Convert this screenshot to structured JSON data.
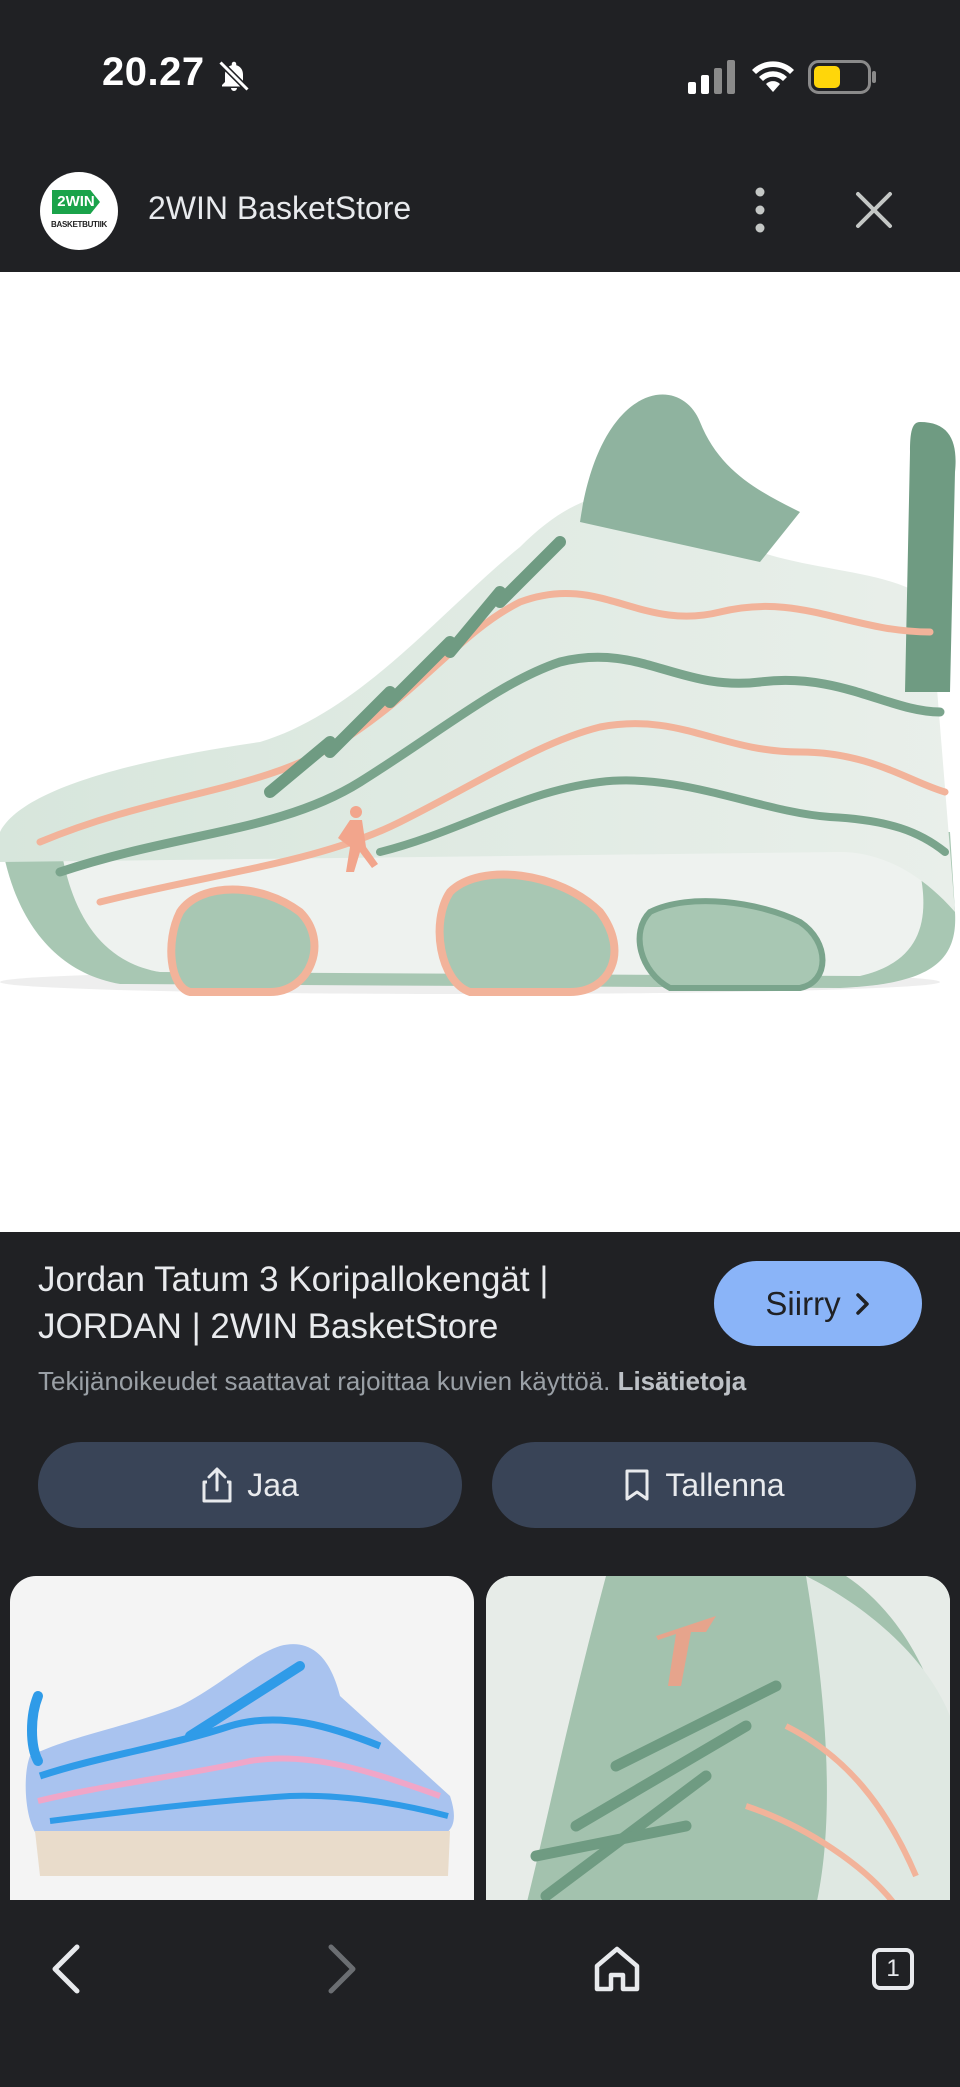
{
  "status_bar": {
    "time": "20.27"
  },
  "app_bar": {
    "site_name": "2WIN BasketStore",
    "logo_text": "2WIN",
    "logo_subtext": "BASKETBUTIIK"
  },
  "result": {
    "title": "Jordan Tatum 3 Koripallokengät | JORDAN | 2WIN BasketStore",
    "visit_label": "Siirry",
    "copyright_text": "Tekijänoikeudet saattavat rajoittaa kuvien käyttöä.",
    "learn_more_label": "Lisätietoja",
    "share_label": "Jaa",
    "save_label": "Tallenna"
  },
  "bottom_nav": {
    "tab_count": "1"
  },
  "colors": {
    "background": "#202124",
    "accent": "#8ab4f8",
    "pill": "#394457",
    "shoe_mint": "#a9c8b5",
    "shoe_peach": "#f2b39a"
  },
  "icons": [
    "bell-off-icon",
    "signal-icon",
    "wifi-icon",
    "battery-icon",
    "more-vert-icon",
    "close-icon",
    "chevron-right-icon",
    "share-icon",
    "bookmark-icon",
    "back-icon",
    "forward-icon",
    "home-icon",
    "tabs-icon"
  ]
}
